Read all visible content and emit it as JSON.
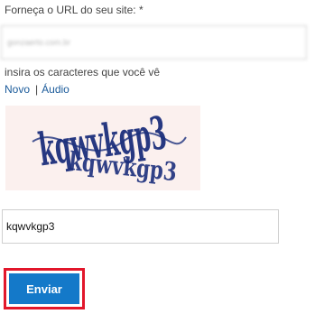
{
  "form": {
    "url_label": "Forneça o URL do seu site: *",
    "url_value": "gonzaerto.com.br",
    "captcha_label": "insira os caracteres que você vê",
    "link_new": "Novo",
    "link_separator": "|",
    "link_audio": "Áudio",
    "captcha_image_text": "kqwvkgp3",
    "captcha_value": "kqwvkgp3",
    "submit_label": "Enviar"
  },
  "colors": {
    "link": "#1a5a9a",
    "submit_background": "#1479c9",
    "highlight_border": "#e2172b",
    "captcha_ink": "#1c2f7c",
    "captcha_background": "#fbf0ee"
  }
}
